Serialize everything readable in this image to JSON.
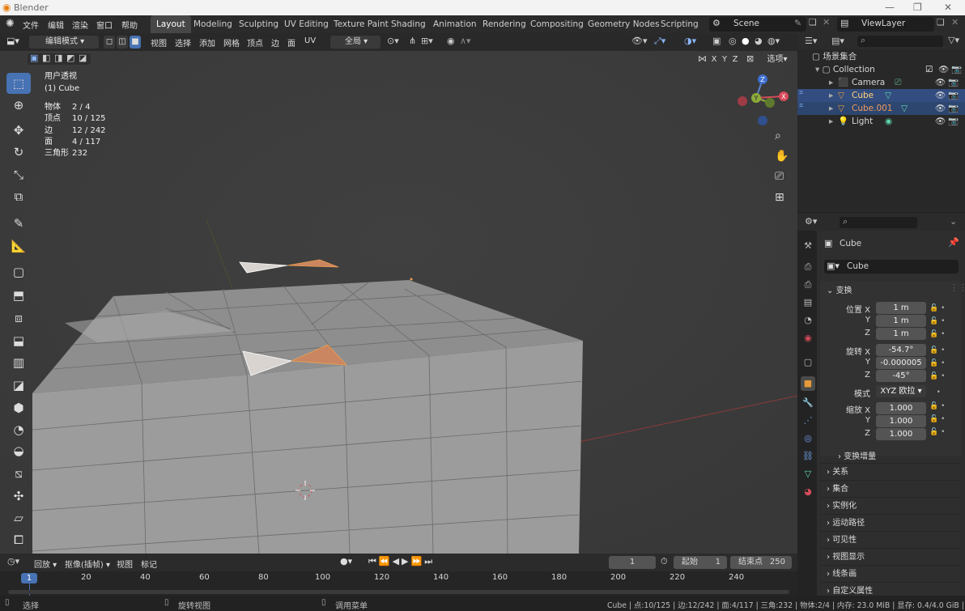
{
  "app": {
    "title": "Blender"
  },
  "menus": [
    "文件",
    "编辑",
    "渲染",
    "窗口",
    "帮助"
  ],
  "workspaces": [
    "Layout",
    "Modeling",
    "Sculpting",
    "UV Editing",
    "Texture Paint",
    "Shading",
    "Animation",
    "Rendering",
    "Compositing",
    "Geometry Nodes",
    "Scripting"
  ],
  "active_workspace": "Layout",
  "scene": {
    "name": "Scene",
    "view_layer": "ViewLayer"
  },
  "viewport_header": {
    "mode": "编辑模式",
    "menus": [
      "视图",
      "选择",
      "添加",
      "网格",
      "顶点",
      "边",
      "面",
      "UV"
    ],
    "transform_orientation": "全局",
    "options_label": "选项",
    "axes": [
      "X",
      "Y",
      "Z"
    ]
  },
  "viewport": {
    "view_name": "用户透视",
    "object_name": "(1) Cube",
    "stats": [
      {
        "label": "物体",
        "value": "2 / 4"
      },
      {
        "label": "顶点",
        "value": "10 / 125"
      },
      {
        "label": "边",
        "value": "12 / 242"
      },
      {
        "label": "面",
        "value": "4 / 117"
      },
      {
        "label": "三角形",
        "value": "232"
      }
    ],
    "gizmo_axes": [
      "Z",
      "Y",
      "X"
    ]
  },
  "outliner": {
    "root": "场景集合",
    "collection": "Collection",
    "items": [
      {
        "name": "Camera",
        "selected": false
      },
      {
        "name": "Cube",
        "selected": true
      },
      {
        "name": "Cube.001",
        "selected": true
      },
      {
        "name": "Light",
        "selected": false
      }
    ]
  },
  "properties": {
    "object_name": "Cube",
    "datablock_name": "Cube",
    "transform_title": "变换",
    "location_label": "位置 X",
    "location": [
      "1 m",
      "1 m",
      "1 m"
    ],
    "rotation_label": "旋转 X",
    "rotation": [
      "-54.7°",
      "-0.000005",
      "-45°"
    ],
    "mode_label": "模式",
    "rotation_mode": "XYZ 欧拉",
    "scale_label": "缩放 X",
    "scale": [
      "1.000",
      "1.000",
      "1.000"
    ],
    "axis_labels": [
      "Y",
      "Z"
    ],
    "delta_transform": "变换增量",
    "sections": [
      "关系",
      "集合",
      "实例化",
      "运动路径",
      "可见性",
      "视图显示",
      "线条画",
      "自定义属性"
    ]
  },
  "timeline": {
    "menus": [
      "回放",
      "抠像(插帧)",
      "视图",
      "标记"
    ],
    "current_frame": "1",
    "start_label": "起始",
    "start": "1",
    "end_label": "结束点",
    "end": "250",
    "ruler": [
      "1",
      "20",
      "40",
      "60",
      "80",
      "100",
      "120",
      "140",
      "160",
      "180",
      "200",
      "220",
      "240"
    ]
  },
  "statusbar": {
    "select": "选择",
    "rotate": "旋转视图",
    "menu": "调用菜单",
    "info": "Cube | 点:10/125 | 边:12/242 | 面:4/117 | 三角:232 | 物体:2/4 | 内存: 23.0 MiB | 显存: 0.4/4.0 GiB | 3.4.1"
  },
  "colors": {
    "accent": "#4772b3",
    "selected_orange": "#f0a050",
    "background": "#3d3d3d"
  }
}
